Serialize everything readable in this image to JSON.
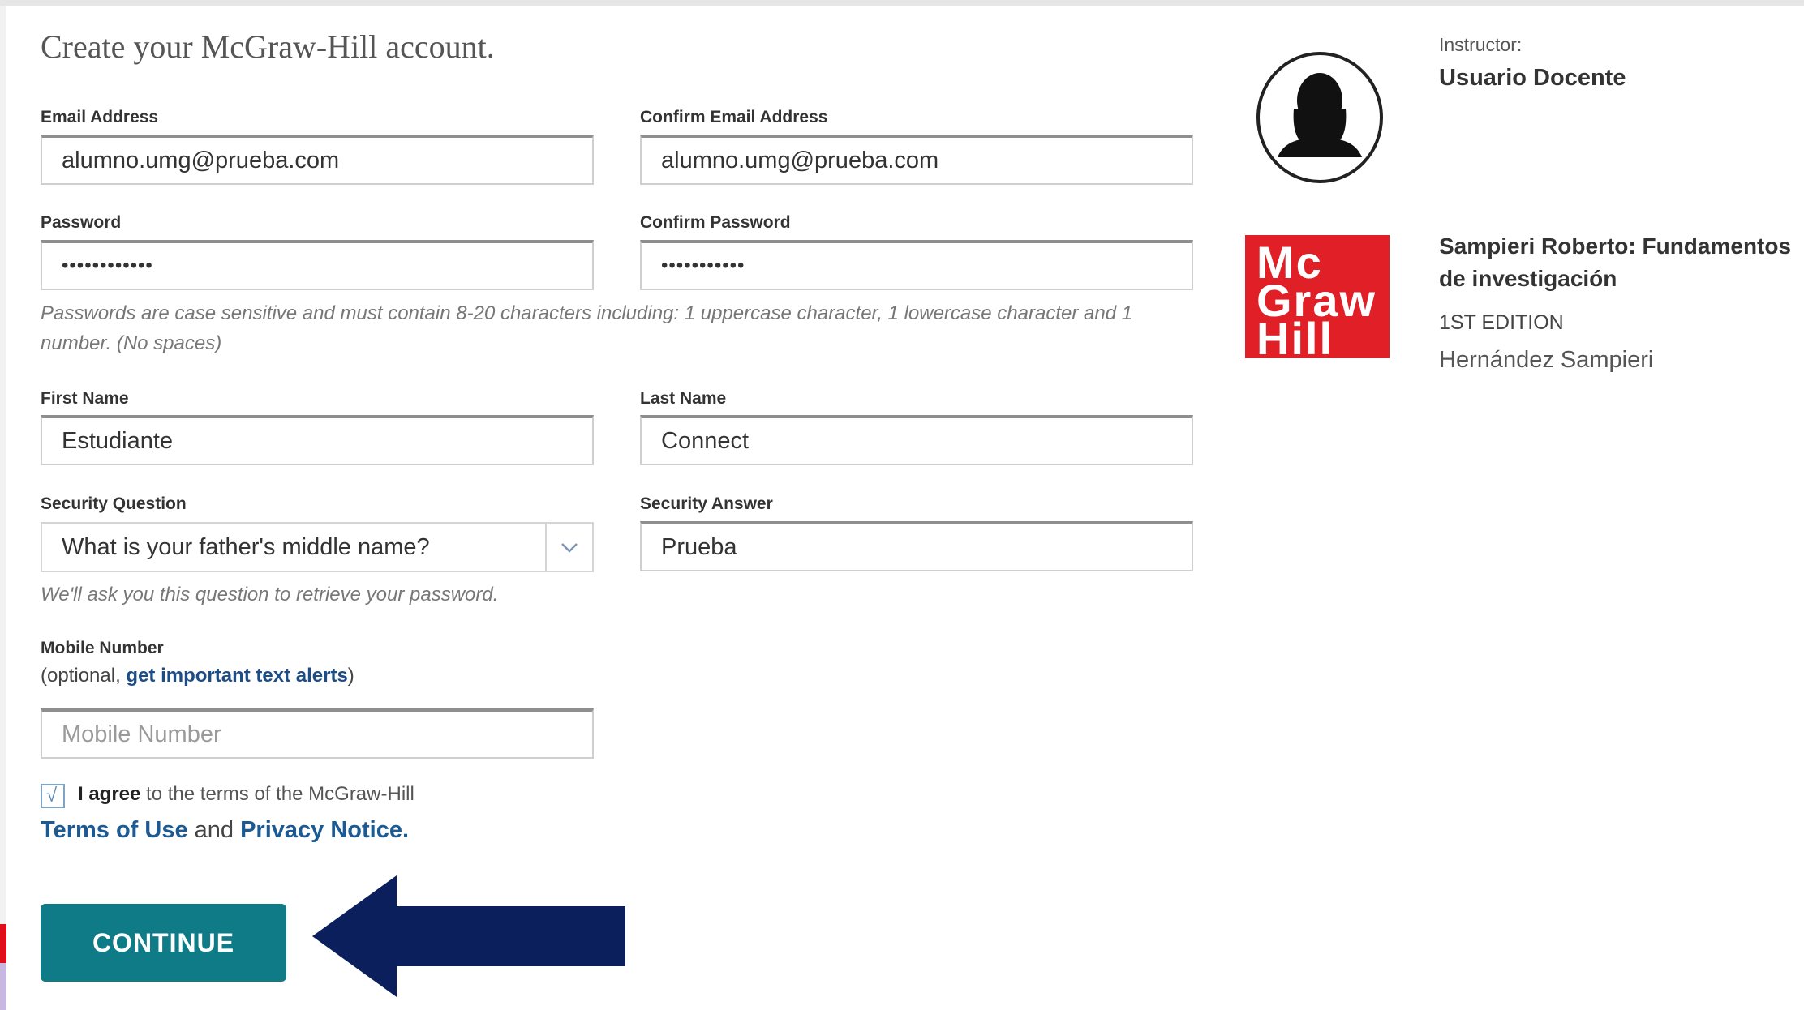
{
  "page": {
    "title": "Create your McGraw-Hill account."
  },
  "form": {
    "email": {
      "label": "Email Address",
      "value": "alumno.umg@prueba.com"
    },
    "confirm_email": {
      "label": "Confirm Email Address",
      "value": "alumno.umg@prueba.com"
    },
    "password": {
      "label": "Password",
      "value": "••••••••••••"
    },
    "confirm_password": {
      "label": "Confirm Password",
      "value": "•••••••••••"
    },
    "password_hint": "Passwords are case sensitive and must contain 8-20 characters including: 1 uppercase character, 1 lowercase character and 1 number. (No spaces)",
    "first_name": {
      "label": "First Name",
      "value": "Estudiante"
    },
    "last_name": {
      "label": "Last Name",
      "value": "Connect"
    },
    "security_question": {
      "label": "Security Question",
      "value": "What is your father's middle name?",
      "icon": "chevron-down-icon"
    },
    "security_answer": {
      "label": "Security Answer",
      "value": "Prueba"
    },
    "security_hint": "We'll ask you this question to retrieve your password.",
    "mobile": {
      "label": "Mobile Number",
      "optional_prefix": "(optional, ",
      "optional_link": "get important text alerts",
      "optional_suffix": ")",
      "placeholder": "Mobile Number"
    },
    "terms": {
      "checked": true,
      "check_mark": "√",
      "agree_bold": "I agree",
      "agree_rest": " to the terms of the McGraw-Hill",
      "terms_link": "Terms of Use",
      "and_text": " and ",
      "privacy_link": "Privacy Notice."
    },
    "continue_label": "CONTINUE"
  },
  "sidebar": {
    "instructor_label": "Instructor:",
    "instructor_name": "Usuario Docente",
    "logo_lines": [
      "Mc",
      "Graw",
      "Hill"
    ],
    "book_title": "Sampieri Roberto: Fundamentos de investigación",
    "edition": "1ST EDITION",
    "author": "Hernández Sampieri"
  },
  "colors": {
    "continue_button": "#0e7b86",
    "arrow": "#0b1f5c",
    "logo": "#e11f26",
    "link": "#1c4d86"
  }
}
